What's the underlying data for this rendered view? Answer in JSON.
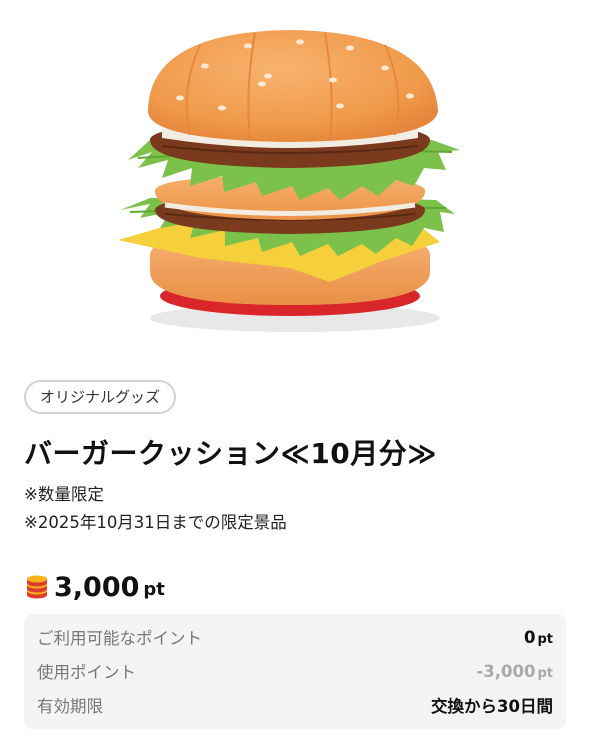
{
  "product": {
    "category_tag": "オリジナルグッズ",
    "title": "バーガークッション≪10月分≫",
    "notes": [
      "※数量限定",
      "※2025年10月31日までの限定景品"
    ],
    "image_alt": "burger cushion"
  },
  "price": {
    "icon": "coin-stack-icon",
    "value": "3,000",
    "unit": "pt"
  },
  "summary": {
    "rows": [
      {
        "label": "ご利用可能なポイント",
        "value": "0",
        "unit": "pt"
      },
      {
        "label": "使用ポイント",
        "value": "-3,000",
        "unit": "pt"
      },
      {
        "label": "有効期限",
        "value": "交換から30日間",
        "unit": ""
      }
    ]
  },
  "colors": {
    "bun": "#f3a55c",
    "lettuce": "#7cc24a",
    "patty": "#7a3a1e",
    "cheese": "#f5d03a",
    "base_red": "#d9262b",
    "coin_red": "#e03a2f",
    "coin_gold": "#f6b31c"
  }
}
